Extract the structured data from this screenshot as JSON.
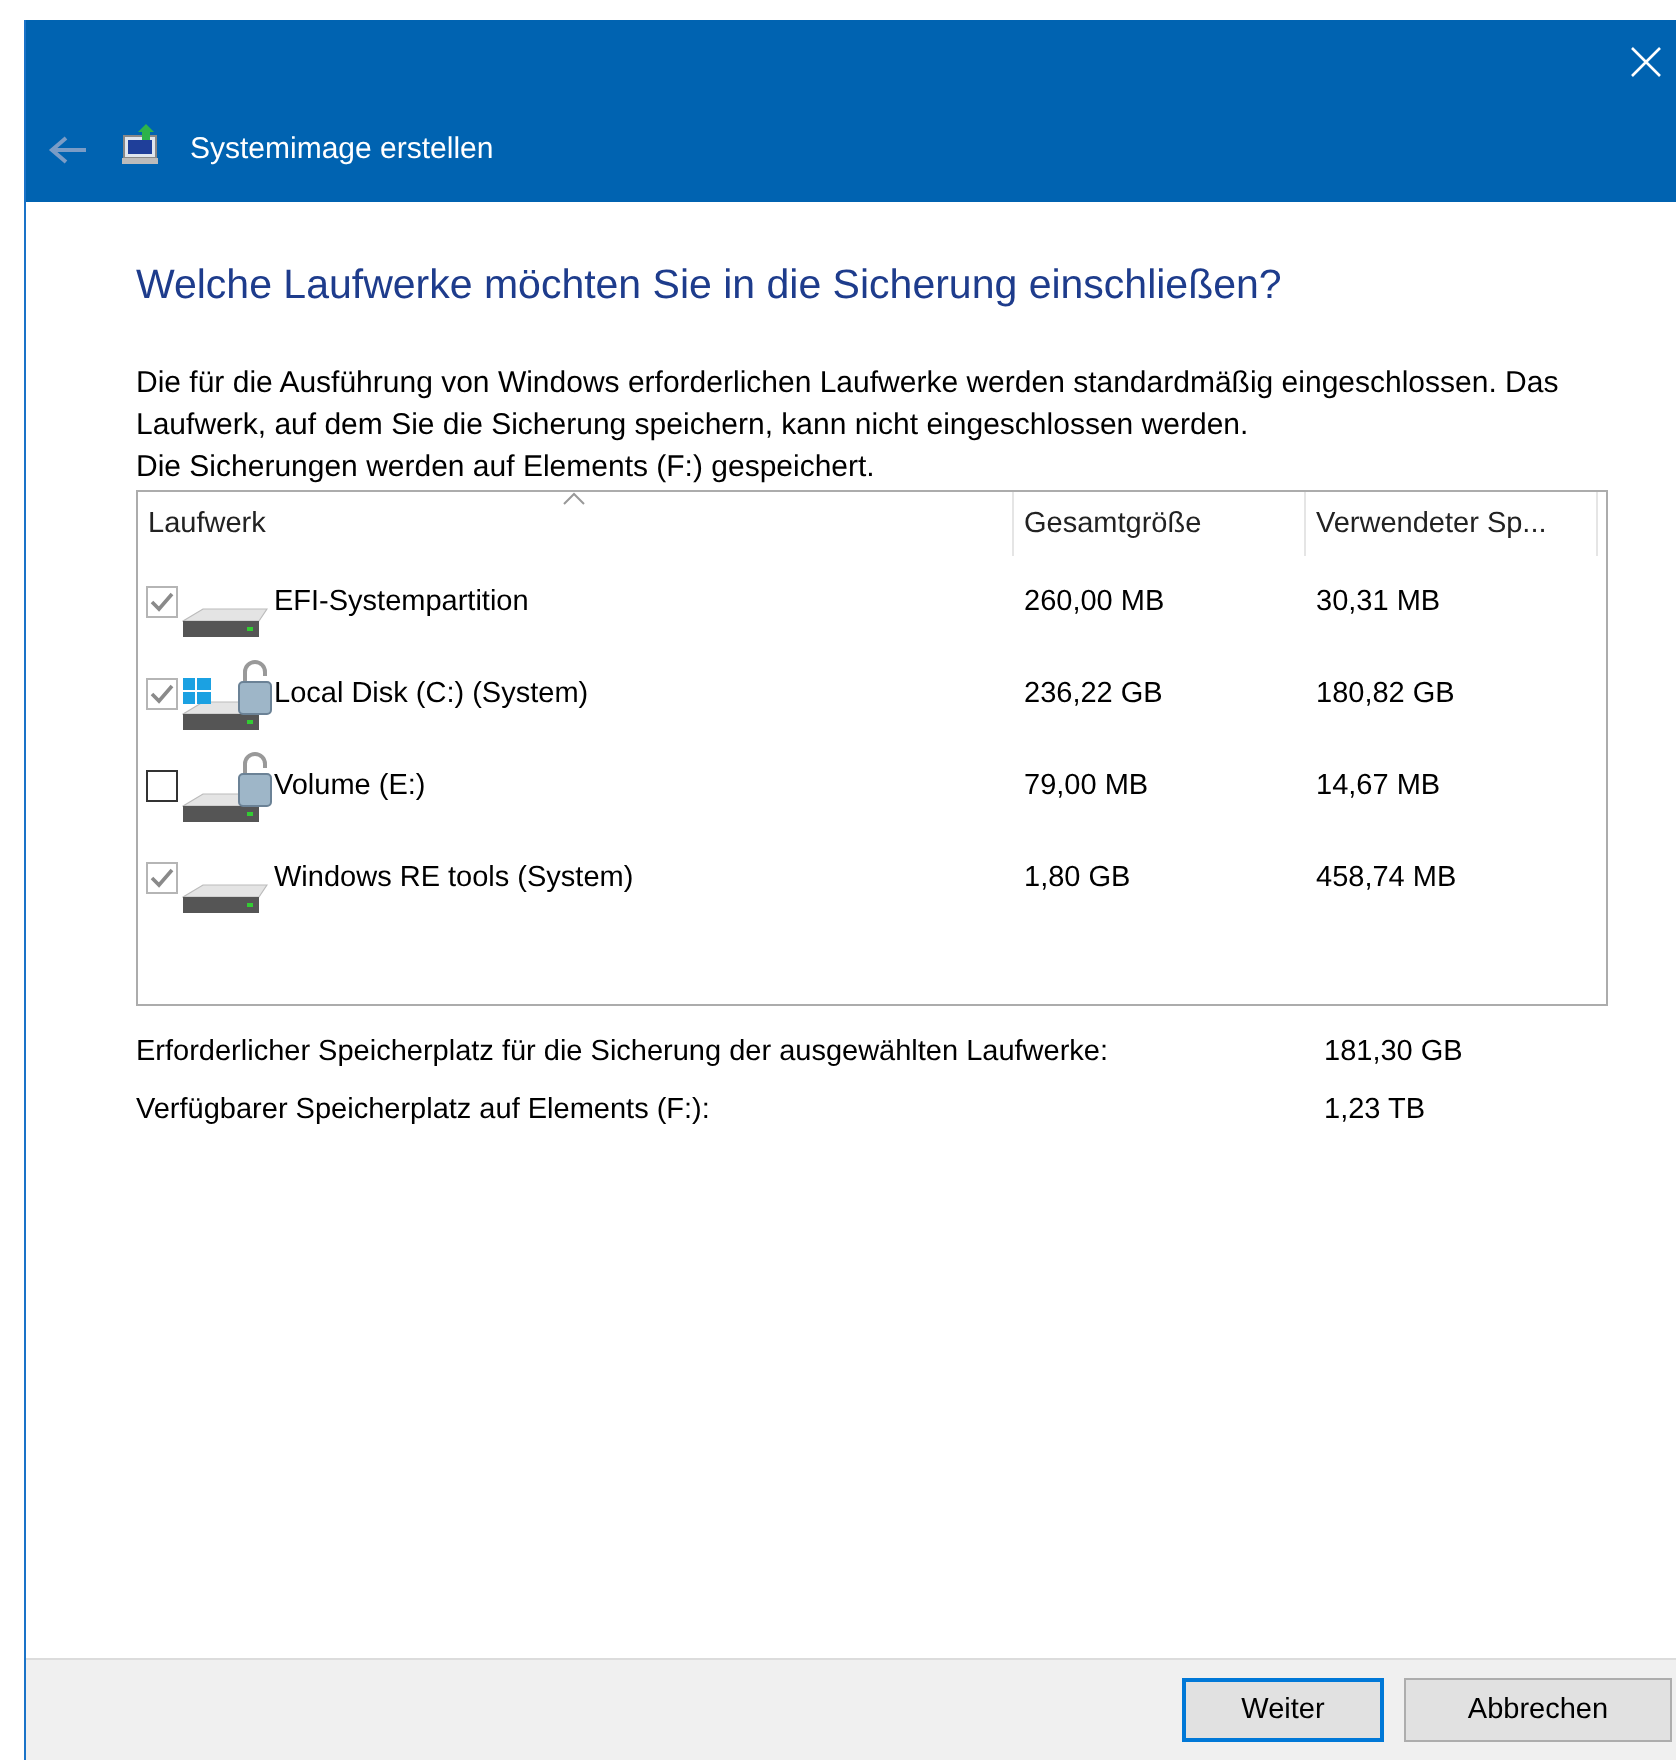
{
  "window": {
    "title": "Systemimage erstellen",
    "back_disabled": true
  },
  "heading": "Welche Laufwerke möchten Sie in die Sicherung einschließen?",
  "description": "Die für die Ausführung von Windows erforderlichen Laufwerke werden standardmäßig eingeschlossen. Das Laufwerk, auf dem Sie die Sicherung speichern, kann nicht eingeschlossen werden.",
  "destination_note": "Die Sicherungen werden auf Elements (F:) gespeichert.",
  "table": {
    "columns": [
      "Laufwerk",
      "Gesamtgröße",
      "Verwendeter Sp..."
    ],
    "rows": [
      {
        "name": "EFI-Systempartition",
        "total": "260,00 MB",
        "used": "30,31 MB",
        "checked": true,
        "disabled": true,
        "windows_logo": false,
        "locked": false
      },
      {
        "name": "Local Disk (C:) (System)",
        "total": "236,22 GB",
        "used": "180,82 GB",
        "checked": true,
        "disabled": true,
        "windows_logo": true,
        "locked": true
      },
      {
        "name": "Volume (E:)",
        "total": "79,00 MB",
        "used": "14,67 MB",
        "checked": false,
        "disabled": false,
        "windows_logo": false,
        "locked": true
      },
      {
        "name": "Windows RE tools (System)",
        "total": "1,80 GB",
        "used": "458,74 MB",
        "checked": true,
        "disabled": true,
        "windows_logo": false,
        "locked": false
      }
    ]
  },
  "summary": [
    {
      "label": "Erforderlicher Speicherplatz für die Sicherung der ausgewählten Laufwerke:",
      "value": "181,30 GB"
    },
    {
      "label": "Verfügbarer Speicherplatz auf Elements (F:):",
      "value": "1,23 TB"
    }
  ],
  "buttons": [
    {
      "label": "Weiter",
      "default": true
    },
    {
      "label": "Abbrechen",
      "default": false
    }
  ]
}
